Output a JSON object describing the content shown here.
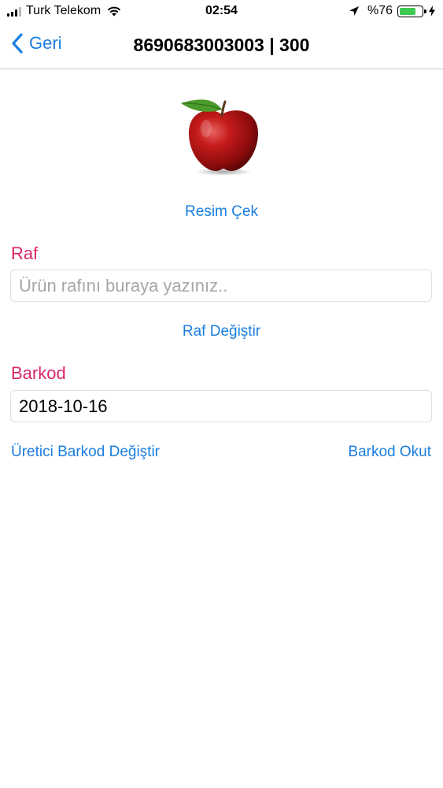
{
  "status_bar": {
    "carrier": "Turk Telekom",
    "time": "02:54",
    "battery_percent": "%76",
    "battery_level": 0.76,
    "battery_color": "#3ec952"
  },
  "nav": {
    "back_label": "Geri",
    "title": "8690683003003 | 300"
  },
  "product": {
    "photo_button": "Resim Çek"
  },
  "shelf": {
    "label": "Raf",
    "placeholder": "Ürün rafını buraya yazınız..",
    "value": "",
    "change_button": "Raf Değiştir"
  },
  "barcode": {
    "label": "Barkod",
    "value": "2018-10-16",
    "manufacturer_change_button": "Üretici Barkod Değiştir",
    "scan_button": "Barkod Okut"
  },
  "colors": {
    "accent": "#1a7ee0",
    "label": "#d7266a"
  }
}
